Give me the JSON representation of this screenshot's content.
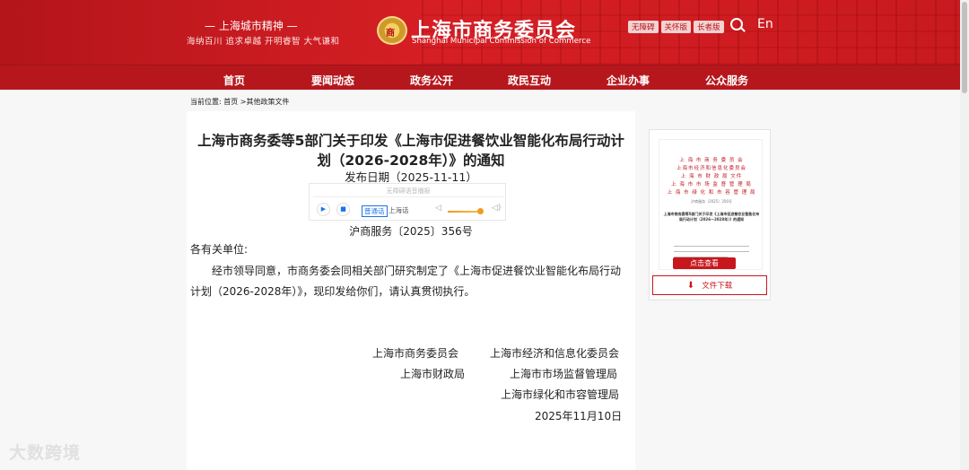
{
  "header": {
    "city_spirit": "— 上海城市精神 —",
    "motto": "海纳百川  追求卓越  开明睿智  大气谦和",
    "emblem_text": "商",
    "site_name": "上海市商务委员会",
    "site_name_en": "Shanghai Municipal Commission of Commerce",
    "tools": [
      "无障碍",
      "关怀版",
      "长者版"
    ],
    "search_icon": "search-icon",
    "lang": "En",
    "brand_color": "#c8161d"
  },
  "nav": [
    "首页",
    "要闻动态",
    "政务公开",
    "政民互动",
    "企业办事",
    "公众服务"
  ],
  "breadcrumb": "当前位置: 首页 >其他政策文件",
  "article": {
    "title": "上海市商务委等5部门关于印发《上海市促进餐饮业智能化布局行动计划（2026-2028年）》的通知",
    "publish": "发布日期（2025-11-11）",
    "player": {
      "caption": "无障碍语音播报",
      "play_icon": "play-icon",
      "stop_icon": "stop-icon",
      "mode1": "普通话",
      "mode2": "上海话",
      "volume_icon": "volume-icon"
    },
    "doc_no": "沪商服务〔2025〕356号",
    "salutation": "各有关单位:",
    "body": "经市领导同意，市商务委会同相关部门研究制定了《上海市促进餐饮业智能化布局行动计划（2026-2028年）》，现印发给你们，请认真贯彻执行。",
    "signatories": [
      "上海市商务委员会",
      "上海市经济和信息化委员会",
      "上海市财政局",
      "上海市市场监督管理局",
      "上海市绿化和市容管理局"
    ],
    "sign_date": "2025年11月10日"
  },
  "side": {
    "thumb_orgs": [
      "上 海 市 商 务 委 员 会",
      "上海市经济和信息化委员会",
      "上 海 市 财 政 局 文件",
      "上 海 市 市 场 监 督 管 理 局",
      "上 海 市 绿 化 和 市 容 管 理 局"
    ],
    "thumb_docno": "沪商服务〔2025〕356号",
    "thumb_title": "上海市商务委等5部门关于印发《上海市促进餐饮业智能化布局行动计划（2026—2028年）》的通知",
    "view": "点击查看",
    "download": "文件下载",
    "download_icon": "download-icon"
  },
  "watermark": "大数跨境"
}
